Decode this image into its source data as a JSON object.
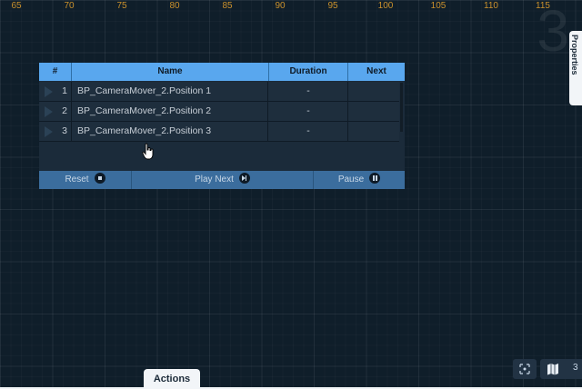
{
  "ruler": {
    "labels": [
      "65",
      "70",
      "75",
      "80",
      "85",
      "90",
      "95",
      "100",
      "105",
      "110",
      "115"
    ]
  },
  "corner_number": "3",
  "side_tab": {
    "label": "Properties"
  },
  "table": {
    "headers": {
      "index": "#",
      "name": "Name",
      "duration": "Duration",
      "next": "Next"
    },
    "rows": [
      {
        "num": "1",
        "name": "BP_CameraMover_2.Position 1",
        "duration": "-",
        "next": ""
      },
      {
        "num": "2",
        "name": "BP_CameraMover_2.Position 2",
        "duration": "-",
        "next": ""
      },
      {
        "num": "3",
        "name": "BP_CameraMover_2.Position 3",
        "duration": "-",
        "next": ""
      }
    ]
  },
  "footer": {
    "reset_label": "Reset",
    "play_next_label": "Play Next",
    "pause_label": "Pause"
  },
  "bottom": {
    "actions_tab_label": "Actions",
    "map_count": "3"
  },
  "colors": {
    "background": "#0f1e2a",
    "header": "#59a7ee",
    "footer": "#3b6d9d",
    "ruler_text": "#c9902c"
  }
}
